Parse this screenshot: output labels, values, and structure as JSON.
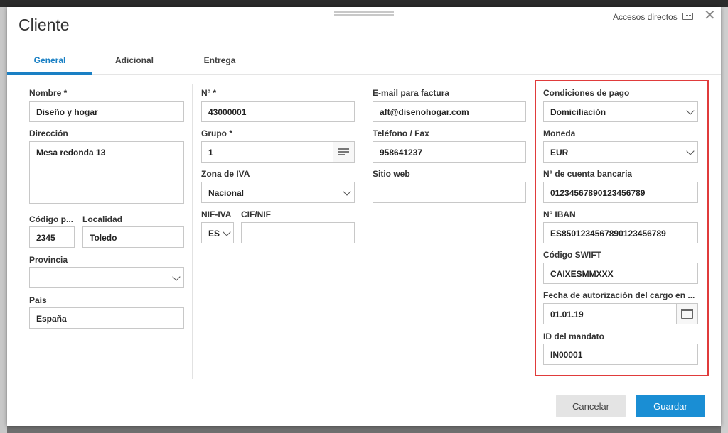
{
  "dialog": {
    "title": "Cliente",
    "shortcuts_label": "Accesos directos"
  },
  "tabs": [
    {
      "label": "General"
    },
    {
      "label": "Adicional"
    },
    {
      "label": "Entrega"
    }
  ],
  "col1": {
    "nombre_label": "Nombre *",
    "nombre_value": "Diseño y hogar",
    "direccion_label": "Dirección",
    "direccion_value": "Mesa redonda 13",
    "codigo_postal_label": "Código p...",
    "codigo_postal_value": "2345",
    "localidad_label": "Localidad",
    "localidad_value": "Toledo",
    "provincia_label": "Provincia",
    "provincia_value": "",
    "pais_label": "País",
    "pais_value": "España"
  },
  "col2": {
    "numero_label": "Nº *",
    "numero_value": "43000001",
    "grupo_label": "Grupo *",
    "grupo_value": "1",
    "zona_iva_label": "Zona de IVA",
    "zona_iva_value": "Nacional",
    "nif_iva_label": "NIF-IVA",
    "nif_iva_value": "ES",
    "cif_nif_label": "CIF/NIF",
    "cif_nif_value": ""
  },
  "col3": {
    "email_label": "E-mail para factura",
    "email_value": "aft@disenohogar.com",
    "telefono_label": "Teléfono / Fax",
    "telefono_value": "958641237",
    "web_label": "Sitio web",
    "web_value": ""
  },
  "col4": {
    "condiciones_label": "Condiciones de pago",
    "condiciones_value": "Domiciliación",
    "moneda_label": "Moneda",
    "moneda_value": "EUR",
    "cuenta_label": "Nº de cuenta bancaria",
    "cuenta_value": "01234567890123456789",
    "iban_label": "Nº IBAN",
    "iban_value": "ES8501234567890123456789",
    "swift_label": "Código SWIFT",
    "swift_value": "CAIXESMMXXX",
    "fecha_label": "Fecha de autorización del cargo en ...",
    "fecha_value": "01.01.19",
    "mandato_label": "ID del mandato",
    "mandato_value": "IN00001"
  },
  "footer": {
    "cancel_label": "Cancelar",
    "save_label": "Guardar"
  },
  "colors": {
    "accent": "#1a80c4",
    "highlight": "#e03b3b"
  }
}
